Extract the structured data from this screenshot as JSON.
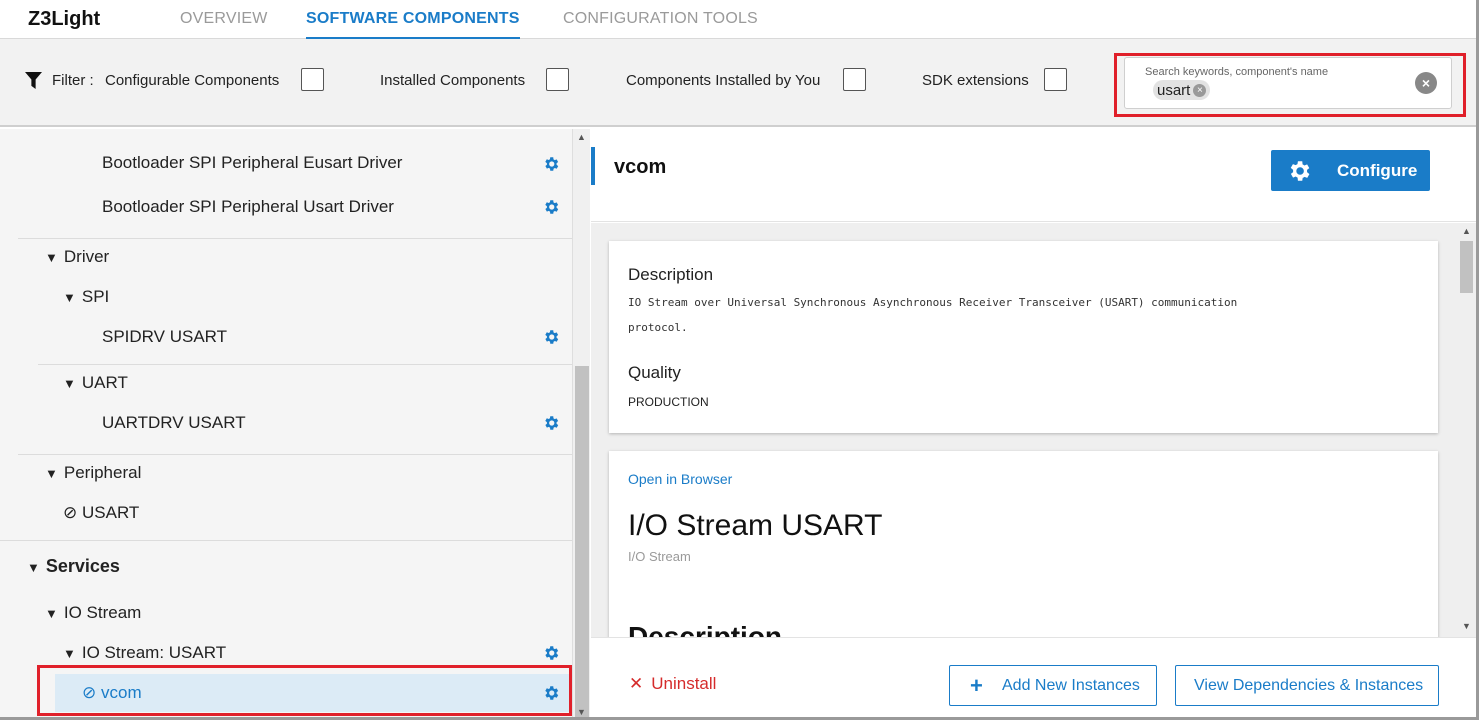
{
  "app": {
    "title": "Z3Light"
  },
  "nav": {
    "tabs": [
      {
        "label": "OVERVIEW",
        "active": false
      },
      {
        "label": "SOFTWARE COMPONENTS",
        "active": true
      },
      {
        "label": "CONFIGURATION TOOLS",
        "active": false
      }
    ]
  },
  "filter": {
    "label": "Filter :",
    "options": [
      {
        "label": "Configurable Components",
        "checked": false
      },
      {
        "label": "Installed Components",
        "checked": false
      },
      {
        "label": "Components Installed by You",
        "checked": false
      },
      {
        "label": "SDK extensions",
        "checked": false
      }
    ],
    "search": {
      "placeholder": "Search keywords, component's name",
      "chip": "usart"
    }
  },
  "tree": {
    "items": [
      {
        "label": "Bootloader SPI Peripheral Eusart Driver",
        "gear": true
      },
      {
        "label": "Bootloader SPI Peripheral Usart Driver",
        "gear": true
      },
      {
        "label": "Driver",
        "caret": true
      },
      {
        "label": "SPI",
        "caret": true
      },
      {
        "label": "SPIDRV USART",
        "gear": true
      },
      {
        "label": "UART",
        "caret": true
      },
      {
        "label": "UARTDRV USART",
        "gear": true
      },
      {
        "label": "Peripheral",
        "caret": true
      },
      {
        "label": "USART",
        "installed": true
      },
      {
        "label": "Services",
        "caret": true
      },
      {
        "label": "IO Stream",
        "caret": true
      },
      {
        "label": "IO Stream: USART",
        "caret": true,
        "gear": true
      },
      {
        "label": "vcom",
        "installed": true,
        "gear": true,
        "selected": true
      }
    ]
  },
  "detail": {
    "title": "vcom",
    "configure_label": "Configure",
    "description_heading": "Description",
    "description_line1": "IO Stream over Universal Synchronous Asynchronous Receiver Transceiver (USART) communication",
    "description_line2": "protocol.",
    "quality_heading": "Quality",
    "quality_value": "PRODUCTION",
    "open_in_browser": "Open in Browser",
    "doc_title": "I/O Stream USART",
    "doc_subtitle": "I/O Stream",
    "doc_description_heading": "Description"
  },
  "actions": {
    "uninstall": "Uninstall",
    "add_instances": "Add New Instances",
    "view_dependencies": "View Dependencies & Instances"
  },
  "colors": {
    "accent": "#1a7cc8",
    "highlight": "#e0202a",
    "danger": "#d52b2b",
    "selected_row": "#dcebf6"
  }
}
